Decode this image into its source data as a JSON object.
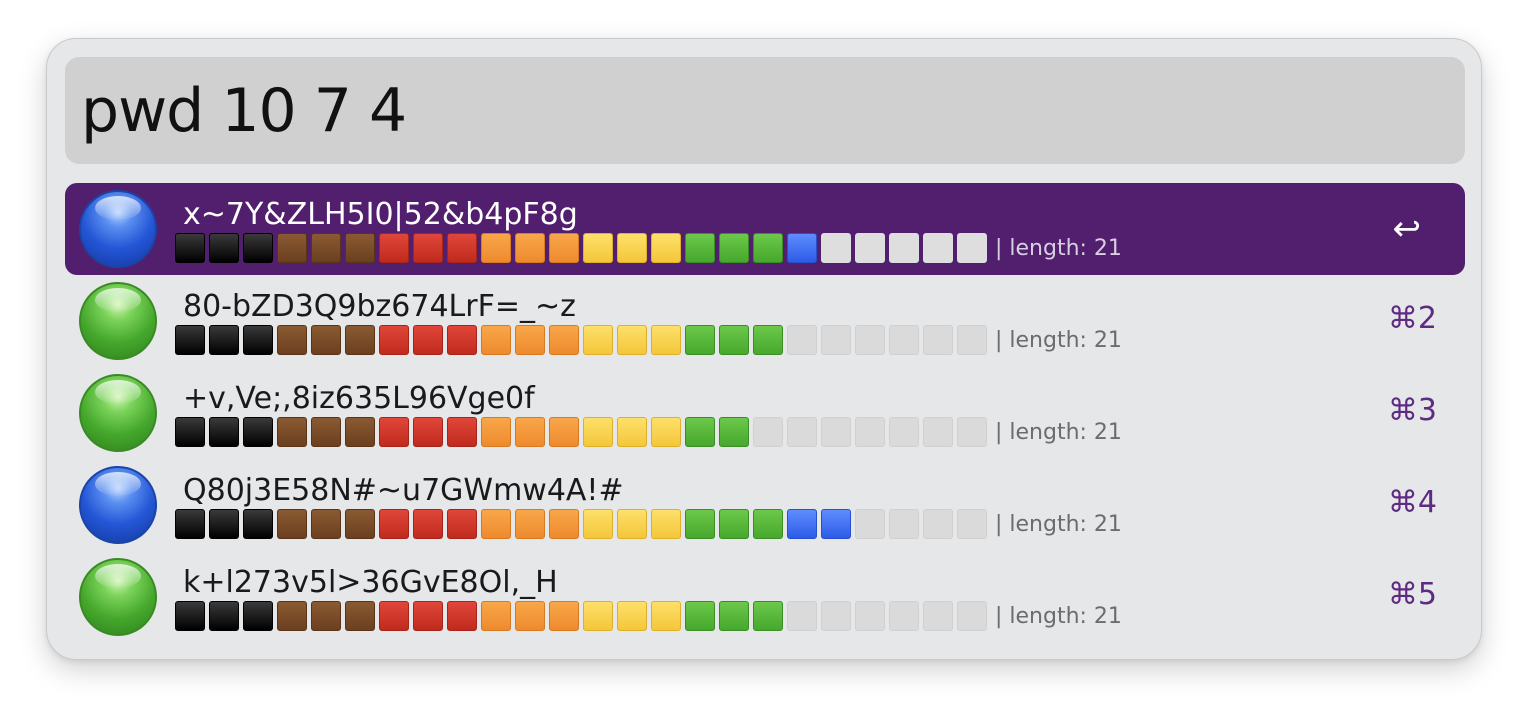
{
  "search": {
    "query": "pwd 10 7 4"
  },
  "colors": {
    "selected_row": "#521e6e",
    "shortcut_text": "#5e2a82",
    "window_bg": "#e6e7e9",
    "search_bg": "#d0d0d0"
  },
  "strength_scale": [
    "black",
    "black",
    "black",
    "brown",
    "brown",
    "brown",
    "red",
    "red",
    "red",
    "orange",
    "orange",
    "orange",
    "yellow",
    "yellow",
    "yellow",
    "green",
    "green",
    "green",
    "blue",
    "blue",
    "blue",
    "blue",
    "blue",
    "blue"
  ],
  "results": [
    {
      "password": "x~7Y&ZLH5I0|52&b4pF8g",
      "orb": "blue-orb-icon",
      "orb_color": "blue",
      "strength": 19,
      "length_label": "| length: 21",
      "shortcut": "↩",
      "selected": true
    },
    {
      "password": "80-bZD3Q9bz674LrF=_~z",
      "orb": "green-orb-icon",
      "orb_color": "green",
      "strength": 18,
      "length_label": "| length: 21",
      "shortcut": "⌘2",
      "selected": false
    },
    {
      "password": "+v,Ve;,8iz635L96Vge0f",
      "orb": "green-orb-icon",
      "orb_color": "green",
      "strength": 17,
      "length_label": "| length: 21",
      "shortcut": "⌘3",
      "selected": false
    },
    {
      "password": "Q80j3E58N#~u7GWmw4A!#",
      "orb": "blue-orb-icon",
      "orb_color": "blue",
      "strength": 20,
      "length_label": "| length: 21",
      "shortcut": "⌘4",
      "selected": false
    },
    {
      "password": "k+l273v5l>36GvE8Ol,_H",
      "orb": "green-orb-icon",
      "orb_color": "green",
      "strength": 18,
      "length_label": "| length: 21",
      "shortcut": "⌘5",
      "selected": false
    }
  ]
}
